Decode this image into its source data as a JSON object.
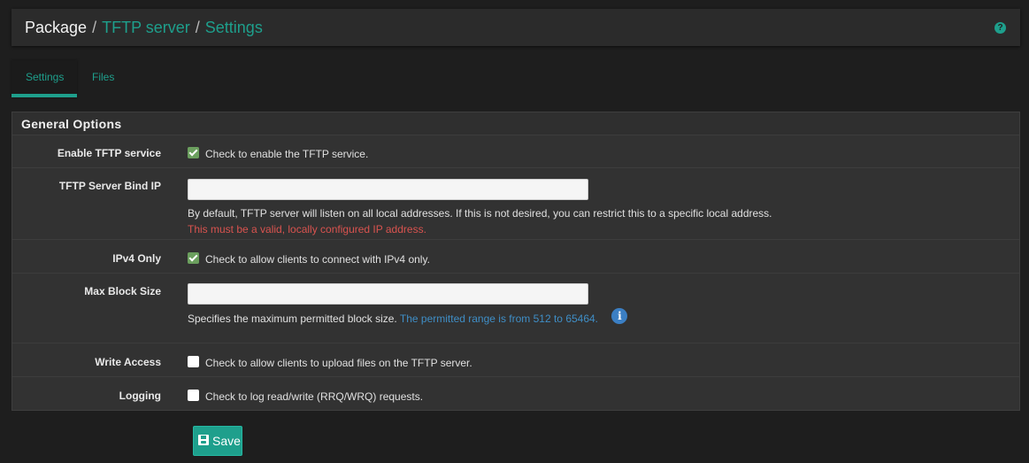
{
  "breadcrumb": {
    "root": "Package",
    "sep": "/",
    "link1": "TFTP server",
    "link2": "Settings"
  },
  "help_icon_glyph": "?",
  "tabs": [
    {
      "label": "Settings",
      "active": true
    },
    {
      "label": "Files",
      "active": false
    }
  ],
  "panel": {
    "title": "General Options",
    "enable": {
      "label": "Enable TFTP service",
      "checked": true,
      "text": "Check to enable the TFTP service."
    },
    "bind_ip": {
      "label": "TFTP Server Bind IP",
      "value": "",
      "help": "By default, TFTP server will listen on all local addresses. If this is not desired, you can restrict this to a specific local address.",
      "error": "This must be a valid, locally configured IP address."
    },
    "ipv4": {
      "label": "IPv4 Only",
      "checked": true,
      "text": "Check to allow clients to connect with IPv4 only."
    },
    "max_block": {
      "label": "Max Block Size",
      "value": "",
      "help": "Specifies the maximum permitted block size.",
      "hint": "The permitted range is from 512 to 65464.",
      "info_glyph": "i"
    },
    "write": {
      "label": "Write Access",
      "checked": false,
      "text": "Check to allow clients to upload files on the TFTP server."
    },
    "logging": {
      "label": "Logging",
      "checked": false,
      "text": "Check to log read/write (RRQ/WRQ) requests."
    }
  },
  "save_label": "Save",
  "colors": {
    "accent": "#1e9f8c",
    "error": "#d9534f",
    "hint": "#3f8ec6",
    "check": "#6b9f5e"
  },
  "icons": {
    "help": "question-circle-icon",
    "info": "info-circle-icon",
    "save": "floppy-icon",
    "check": "checkmark-icon"
  }
}
